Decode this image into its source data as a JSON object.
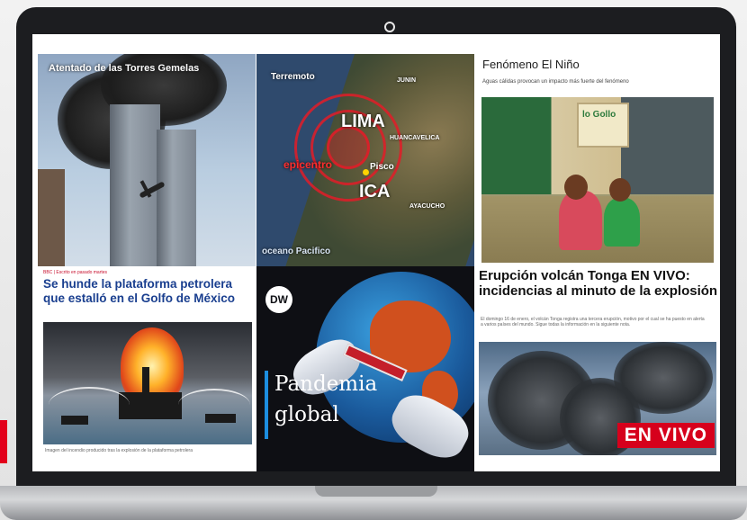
{
  "tiles": {
    "towers": {
      "caption": "Atentado de las Torres Gemelas"
    },
    "quake": {
      "caption": "Terremoto",
      "cities": [
        "LIMA",
        "ICA",
        "Pisco",
        "JUNIN",
        "HUANCAVELICA",
        "AYACUCHO"
      ],
      "epicenter": "epicentro",
      "ocean": "oceano Pacifico"
    },
    "nino": {
      "title": "Fenómeno El Niño",
      "subtitle": "Aguas cálidas provocan un impacto más fuerte del fenómeno",
      "sign_text": "lo Gollo"
    },
    "oil": {
      "kicker": "BBC | Escrito en pasado martes",
      "headline": "Se hunde la plataforma petrolera que estalló en el Golfo de México",
      "photo_caption": "Imagen del incendio producido tras la explosión de la plataforma petrolera"
    },
    "pandemic": {
      "logo": "DW",
      "line1": "Pandemia",
      "line2": "global"
    },
    "tonga": {
      "headline": "Erupción volcán Tonga EN VIVO: incidencias al minuto de la explosión",
      "summary": "El domingo 16 de enero, el volcán Tonga registra una tercera erupción, motivo por el cual se ha puesto en alerta a varios países del mundo. Sigue todas la información en la siguiente nota.",
      "badge": "EN VIVO"
    }
  },
  "colors": {
    "accent_red": "#e3001b",
    "laptop_frame": "#1c1d20",
    "headline_blue": "#1a3f8f"
  }
}
